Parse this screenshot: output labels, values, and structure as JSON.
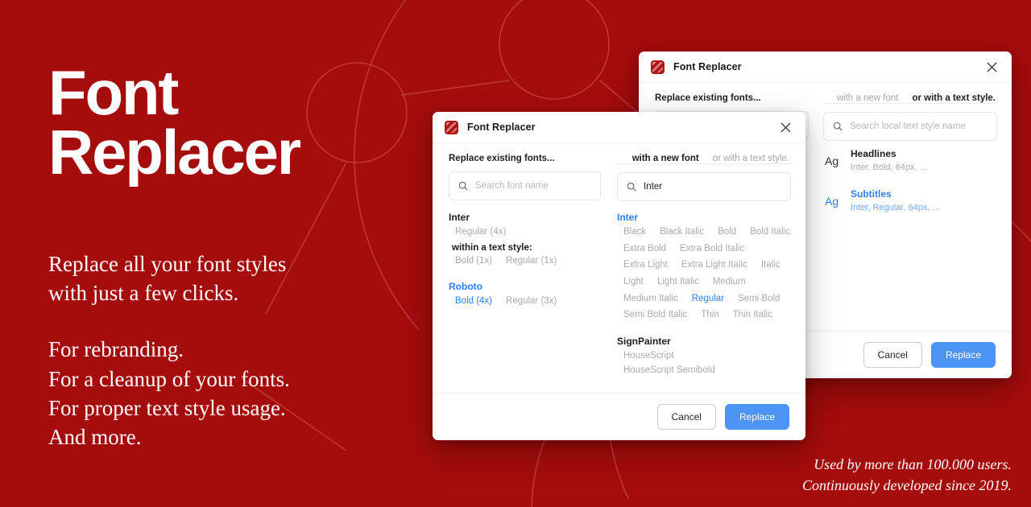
{
  "theme": {
    "background": "#A50C0C",
    "accent_blue": "#2F80F7",
    "primary_button": "#4D94F7"
  },
  "promo": {
    "title_line1": "Font",
    "title_line2": "Replacer",
    "body_line1": "Replace all your font styles",
    "body_line2": "with just a few clicks.",
    "body_line3": "For rebranding.",
    "body_line4": "For a cleanup of your fonts.",
    "body_line5": "For proper text style usage.",
    "body_line6": "And more.",
    "tagline_line1": "Used by more than 100.000 users.",
    "tagline_line2": "Continuously developed since 2019."
  },
  "back_dialog": {
    "title": "Font Replacer",
    "close_icon": "close-icon",
    "app_icon": "font-replacer-app-icon",
    "tab_left": "Replace existing fonts...",
    "tab_new_font": "with a new font",
    "tab_text_style": "or with a text style.",
    "left_search_clear_icon": "clear-icon",
    "search_placeholder": "Search local text style name",
    "search_icon": "search-icon",
    "text_styles": [
      {
        "preview": "Ag",
        "name": "Headlines",
        "desc": "Inter, Bold, 64px, ...",
        "selected": false
      },
      {
        "preview": "Ag",
        "name": "Subtitles",
        "desc": "Inter, Regular, 64px, ...",
        "selected": true
      }
    ],
    "cancel_label": "Cancel",
    "replace_label": "Replace"
  },
  "front_dialog": {
    "title": "Font Replacer",
    "close_icon": "close-icon",
    "app_icon": "font-replacer-app-icon",
    "tab_left": "Replace existing fonts...",
    "tab_new_font": "with a new font",
    "tab_text_style": "or with a text style.",
    "left_search_placeholder": "Search font name",
    "left_search_icon": "search-icon",
    "right_search_value": "Inter",
    "right_search_icon": "search-icon",
    "right_clear_icon": "clear-icon",
    "existing_fonts": [
      {
        "family": "Inter",
        "selected": false,
        "styles": [
          {
            "label": "Regular (4x)",
            "selected": false
          }
        ],
        "within_label": "within a text style:",
        "within_styles": [
          {
            "label": "Bold (1x)",
            "selected": false
          },
          {
            "label": "Regular (1x)",
            "selected": false
          }
        ]
      },
      {
        "family": "Roboto",
        "selected": true,
        "styles": [
          {
            "label": "Bold (4x)",
            "selected": true
          },
          {
            "label": "Regular (3x)",
            "selected": false
          }
        ]
      }
    ],
    "new_fonts": [
      {
        "family": "Inter",
        "selected": true,
        "styles": [
          {
            "label": "Black",
            "selected": false
          },
          {
            "label": "Black Italic",
            "selected": false
          },
          {
            "label": "Bold",
            "selected": false
          },
          {
            "label": "Bold Italic",
            "selected": false
          },
          {
            "label": "Extra Bold",
            "selected": false
          },
          {
            "label": "Extra Bold Italic",
            "selected": false
          },
          {
            "label": "Extra Light",
            "selected": false
          },
          {
            "label": "Extra Light Italic",
            "selected": false
          },
          {
            "label": "Italic",
            "selected": false
          },
          {
            "label": "Light",
            "selected": false
          },
          {
            "label": "Light Italic",
            "selected": false
          },
          {
            "label": "Medium",
            "selected": false
          },
          {
            "label": "Medium Italic",
            "selected": false
          },
          {
            "label": "Regular",
            "selected": true
          },
          {
            "label": "Semi Bold",
            "selected": false
          },
          {
            "label": "Semi Bold Italic",
            "selected": false
          },
          {
            "label": "Thin",
            "selected": false
          },
          {
            "label": "Thin Italic",
            "selected": false
          }
        ]
      },
      {
        "family": "SignPainter",
        "selected": false,
        "styles": [
          {
            "label": "HouseScript",
            "selected": false
          },
          {
            "label": "HouseScript Semibold",
            "selected": false
          }
        ]
      }
    ],
    "cancel_label": "Cancel",
    "replace_label": "Replace"
  }
}
